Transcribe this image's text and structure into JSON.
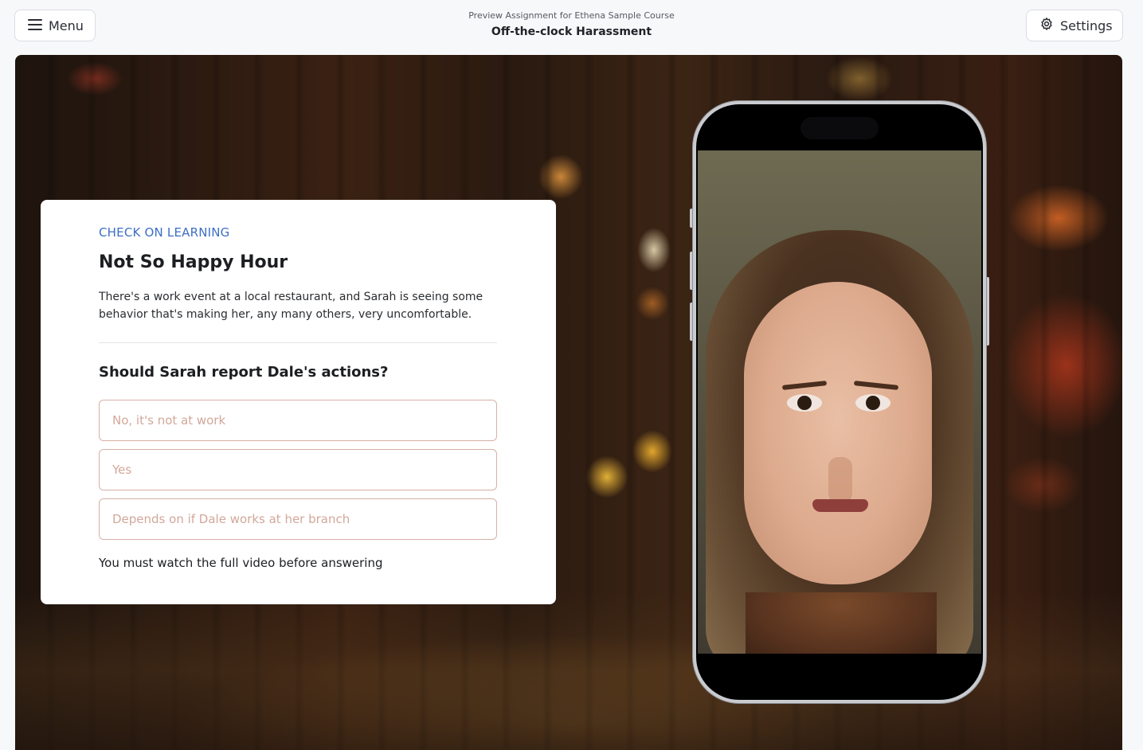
{
  "header": {
    "menu_label": "Menu",
    "subtitle": "Preview Assignment for Ethena Sample Course",
    "title": "Off-the-clock Harassment",
    "settings_label": "Settings"
  },
  "card": {
    "eyebrow": "CHECK ON LEARNING",
    "title": "Not So Happy Hour",
    "description": "There's a work event at a local restaurant, and Sarah is seeing some behavior that's making her, any many others, very uncomfortable.",
    "question": "Should Sarah report Dale's actions?",
    "options": [
      {
        "label": "No, it's not at work"
      },
      {
        "label": "Yes"
      },
      {
        "label": "Depends on if Dale works at her branch"
      }
    ],
    "notice": "You must watch the full video before answering"
  },
  "icons": {
    "menu": "hamburger-menu-icon",
    "settings": "gear-icon"
  },
  "colors": {
    "accent": "#3d6fc4",
    "option_border": "#d7b0a6",
    "option_text": "#d2a79a"
  }
}
